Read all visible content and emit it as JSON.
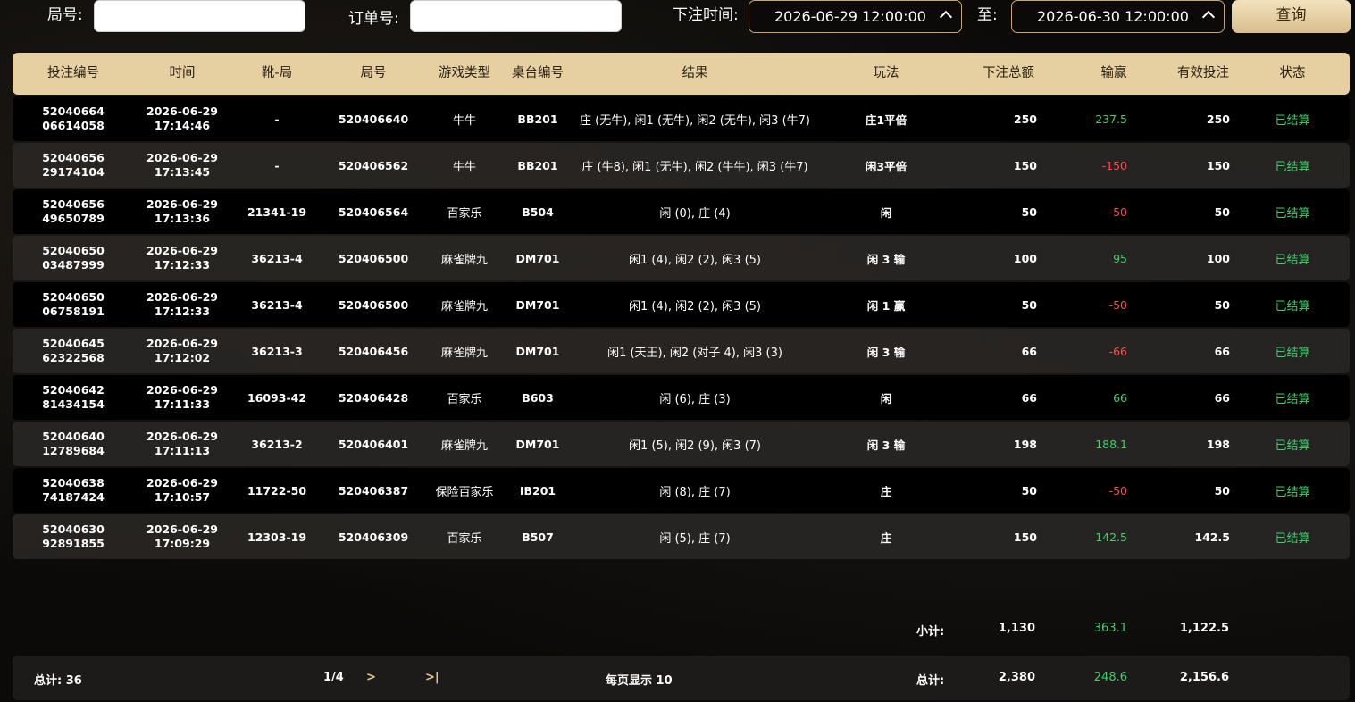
{
  "filters": {
    "round_label": "局号:",
    "round_value": "",
    "order_label": "订单号:",
    "order_value": "",
    "time_label": "下注时间:",
    "start_time": "2026-06-29 12:00:00",
    "to_label": "至:",
    "end_time": "2026-06-30 12:00:00",
    "query_label": "查询"
  },
  "table": {
    "headers": [
      "投注编号",
      "时间",
      "靴-局",
      "局号",
      "游戏类型",
      "桌台编号",
      "结果",
      "玩法",
      "下注总额",
      "输赢",
      "有效投注",
      "状态"
    ],
    "rows": [
      {
        "id1": "52040664",
        "id2": "06614058",
        "date": "2026-06-29",
        "time": "17:14:46",
        "shoe": "-",
        "round": "520406640",
        "game": "牛牛",
        "table": "BB201",
        "result": "庄 (无牛), 闲1 (无牛), 闲2 (无牛), 闲3 (牛7)",
        "play": "庄1平倍",
        "bet": "250",
        "winloss": "237.5",
        "valid": "250",
        "status": "已结算"
      },
      {
        "id1": "52040656",
        "id2": "29174104",
        "date": "2026-06-29",
        "time": "17:13:45",
        "shoe": "-",
        "round": "520406562",
        "game": "牛牛",
        "table": "BB201",
        "result": "庄 (牛8), 闲1 (无牛), 闲2 (牛牛), 闲3 (牛7)",
        "play": "闲3平倍",
        "bet": "150",
        "winloss": "-150",
        "valid": "150",
        "status": "已结算"
      },
      {
        "id1": "52040656",
        "id2": "49650789",
        "date": "2026-06-29",
        "time": "17:13:36",
        "shoe": "21341-19",
        "round": "520406564",
        "game": "百家乐",
        "table": "B504",
        "result": "闲 (0), 庄 (4)",
        "play": "闲",
        "bet": "50",
        "winloss": "-50",
        "valid": "50",
        "status": "已结算"
      },
      {
        "id1": "52040650",
        "id2": "03487999",
        "date": "2026-06-29",
        "time": "17:12:33",
        "shoe": "36213-4",
        "round": "520406500",
        "game": "麻雀牌九",
        "table": "DM701",
        "result": "闲1 (4), 闲2 (2), 闲3 (5)",
        "play": "闲 3 输",
        "bet": "100",
        "winloss": "95",
        "valid": "100",
        "status": "已结算"
      },
      {
        "id1": "52040650",
        "id2": "06758191",
        "date": "2026-06-29",
        "time": "17:12:33",
        "shoe": "36213-4",
        "round": "520406500",
        "game": "麻雀牌九",
        "table": "DM701",
        "result": "闲1 (4), 闲2 (2), 闲3 (5)",
        "play": "闲 1 赢",
        "bet": "50",
        "winloss": "-50",
        "valid": "50",
        "status": "已结算"
      },
      {
        "id1": "52040645",
        "id2": "62322568",
        "date": "2026-06-29",
        "time": "17:12:02",
        "shoe": "36213-3",
        "round": "520406456",
        "game": "麻雀牌九",
        "table": "DM701",
        "result": "闲1 (天王), 闲2 (对子 4), 闲3 (3)",
        "play": "闲 3 输",
        "bet": "66",
        "winloss": "-66",
        "valid": "66",
        "status": "已结算"
      },
      {
        "id1": "52040642",
        "id2": "81434154",
        "date": "2026-06-29",
        "time": "17:11:33",
        "shoe": "16093-42",
        "round": "520406428",
        "game": "百家乐",
        "table": "B603",
        "result": "闲 (6), 庄 (3)",
        "play": "闲",
        "bet": "66",
        "winloss": "66",
        "valid": "66",
        "status": "已结算"
      },
      {
        "id1": "52040640",
        "id2": "12789684",
        "date": "2026-06-29",
        "time": "17:11:13",
        "shoe": "36213-2",
        "round": "520406401",
        "game": "麻雀牌九",
        "table": "DM701",
        "result": "闲1 (5), 闲2 (9), 闲3 (7)",
        "play": "闲 3 输",
        "bet": "198",
        "winloss": "188.1",
        "valid": "198",
        "status": "已结算"
      },
      {
        "id1": "52040638",
        "id2": "74187424",
        "date": "2026-06-29",
        "time": "17:10:57",
        "shoe": "11722-50",
        "round": "520406387",
        "game": "保险百家乐",
        "table": "IB201",
        "result": "闲 (8), 庄 (7)",
        "play": "庄",
        "bet": "50",
        "winloss": "-50",
        "valid": "50",
        "status": "已结算"
      },
      {
        "id1": "52040630",
        "id2": "92891855",
        "date": "2026-06-29",
        "time": "17:09:29",
        "shoe": "12303-19",
        "round": "520406309",
        "game": "百家乐",
        "table": "B507",
        "result": "闲 (5), 庄 (7)",
        "play": "庄",
        "bet": "150",
        "winloss": "142.5",
        "valid": "142.5",
        "status": "已结算"
      }
    ]
  },
  "subtotal": {
    "label": "小计:",
    "bet": "1,130",
    "winloss": "363.1",
    "valid": "1,122.5"
  },
  "footer": {
    "count": "总计: 36",
    "page": "1/4",
    "next": ">",
    "last": ">|",
    "page_size": "每页显示 10",
    "total_label": "总计:",
    "bet": "2,380",
    "winloss": "248.6",
    "valid": "2,156.6"
  },
  "colors": {
    "header_bg": "#e6cfa1",
    "accent": "#c7a56d",
    "positive": "#3bd26b",
    "negative": "#ff4a4a"
  }
}
